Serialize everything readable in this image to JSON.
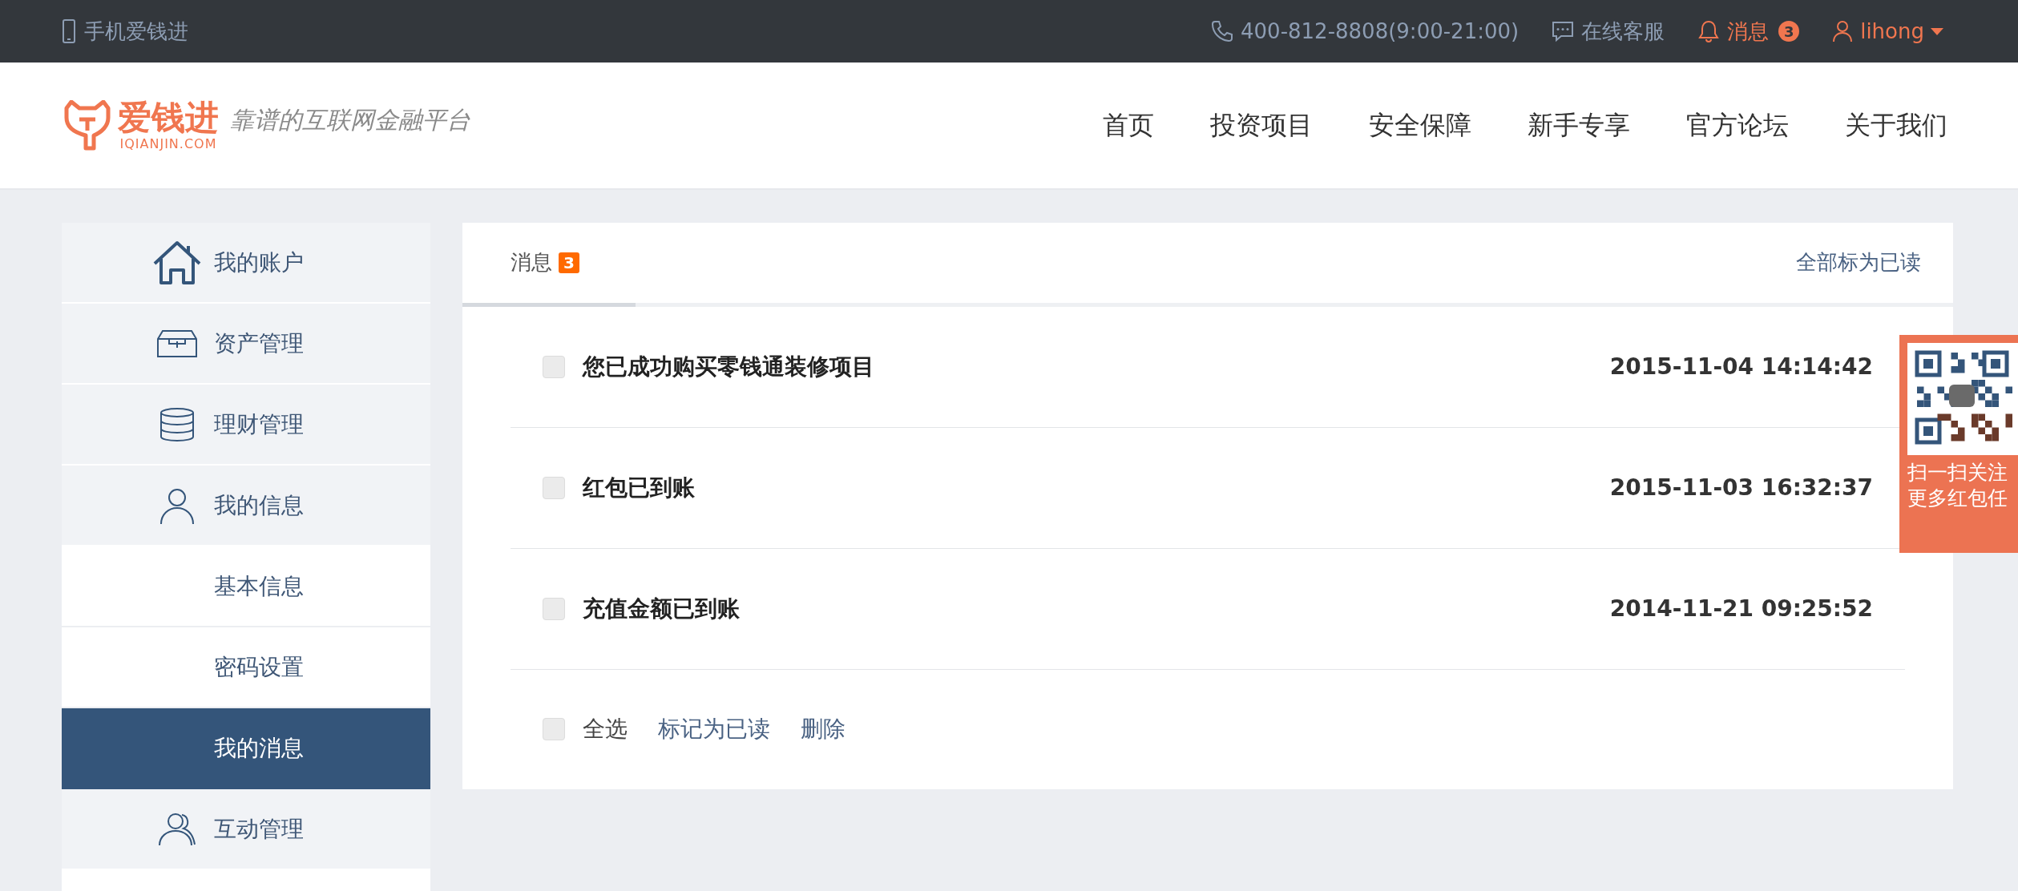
{
  "top_bar": {
    "mobile_link": "手机爱钱进",
    "hotline": "400-812-8808(9:00-21:00)",
    "support_link": "在线客服",
    "messages": {
      "label": "消息",
      "count": "3"
    },
    "user": {
      "name": "lihong"
    }
  },
  "header": {
    "logo": {
      "name": "爱钱进",
      "domain": "IQIANJIN.COM",
      "slogan": "靠谱的互联网金融平台"
    },
    "nav": [
      {
        "label": "首页"
      },
      {
        "label": "投资项目"
      },
      {
        "label": "安全保障"
      },
      {
        "label": "新手专享"
      },
      {
        "label": "官方论坛"
      },
      {
        "label": "关于我们"
      }
    ]
  },
  "sidebar": {
    "items": [
      {
        "label": "我的账户",
        "selected": false
      },
      {
        "label": "资产管理",
        "selected": false
      },
      {
        "label": "理财管理",
        "selected": false
      },
      {
        "label": "我的信息",
        "selected": false,
        "children": [
          {
            "label": "基本信息",
            "selected": false
          },
          {
            "label": "密码设置",
            "selected": false
          },
          {
            "label": "我的消息",
            "selected": true
          }
        ]
      },
      {
        "label": "互动管理",
        "selected": false
      }
    ]
  },
  "messages_panel": {
    "tabs": [
      {
        "label": "消息",
        "badge": "3",
        "selected": true
      }
    ],
    "mark_all_read": "全部标为已读",
    "messages": [
      {
        "title": "您已成功购买零钱通装修项目",
        "time": "2015-11-04 14:14:42",
        "checked": false
      },
      {
        "title": "红包已到账",
        "time": "2015-11-03 16:32:37",
        "checked": false
      },
      {
        "title": "充值金额已到账",
        "time": "2014-11-21 09:25:52",
        "checked": false
      }
    ],
    "footer": {
      "select_all": {
        "label": "全选",
        "checked": false
      },
      "actions": [
        "标记为已读",
        "删除"
      ]
    }
  },
  "qr_widget": {
    "lines": [
      "扫一扫关注",
      "更多红包任"
    ]
  }
}
